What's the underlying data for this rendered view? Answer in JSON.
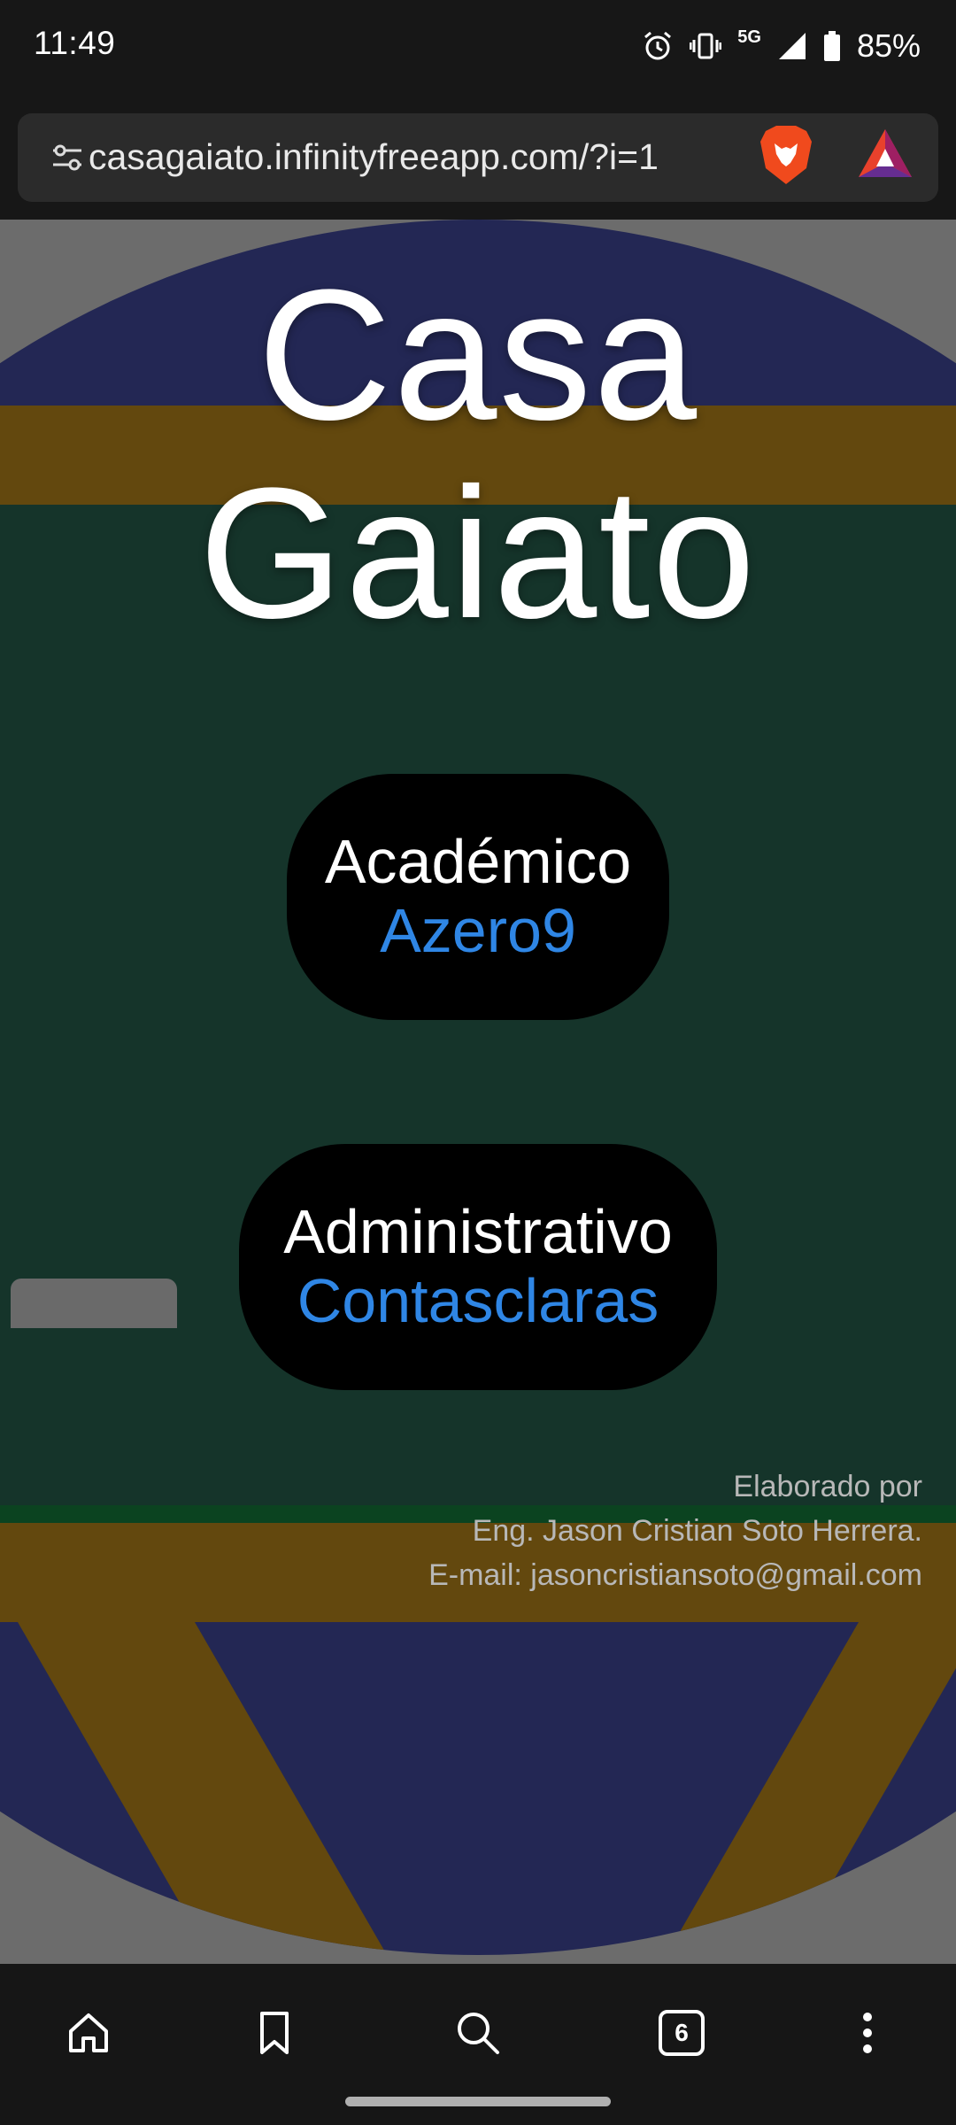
{
  "status_bar": {
    "time": "11:49",
    "network": "5G",
    "battery": "85%",
    "icons": [
      "alarm-icon",
      "vibrate-icon",
      "signal-icon",
      "battery-icon"
    ]
  },
  "browser": {
    "url": "casagaiato.infinityfreeapp.com/?i=1",
    "icons": [
      "site-settings-icon",
      "brave-lion-icon",
      "brave-rewards-icon"
    ],
    "tab_count": "6",
    "nav_icons": [
      "home-icon",
      "bookmark-icon",
      "search-icon",
      "tabs-icon",
      "more-icon"
    ]
  },
  "page": {
    "title_line1": "Casa",
    "title_line2": "Gaiato",
    "buttons": [
      {
        "label": "Académico",
        "sublabel": "Azero9"
      },
      {
        "label": "Administrativo",
        "sublabel": "Contasclaras"
      }
    ],
    "footer": {
      "line1": "Elaborado por",
      "line2": "Eng. Jason Cristian Soto Herrera.",
      "line3": "E-mail: jasoncristiansoto@gmail.com"
    }
  },
  "colors": {
    "link_blue": "#2f86e5",
    "circle_navy": "#232754",
    "stripe_gold": "#63480e",
    "band_green": "#15342a"
  }
}
